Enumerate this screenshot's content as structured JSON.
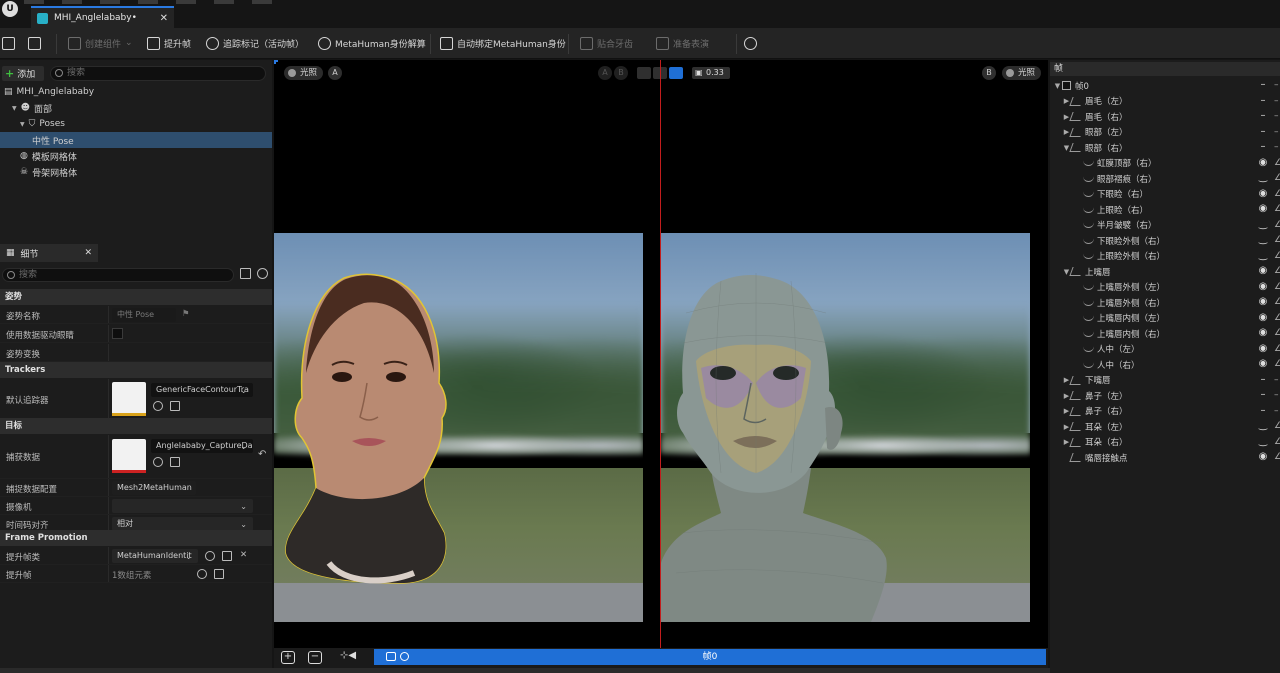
{
  "app": {
    "document_tab": "MHI_Anglelababy•",
    "logo": "U"
  },
  "toolbar": {
    "create_components": "创建组件",
    "promote_frame": "提升帧",
    "track_markers": "追踪标记（活动帧）",
    "metahuman_identity_solve": "MetaHuman身份解算",
    "auto_rig": "自动绑定MetaHuman身份",
    "fit_teeth": "贴合牙齿",
    "prepare_expression": "准备表演"
  },
  "outliner": {
    "add_label": "添加",
    "search_placeholder": "搜索",
    "items": [
      {
        "label": "MHI_Anglelababy",
        "indent": 0,
        "icon": "component-icon"
      },
      {
        "label": "面部",
        "indent": 1,
        "icon": "face-icon"
      },
      {
        "label": "Poses",
        "indent": 2,
        "icon": "poses-icon"
      },
      {
        "label": "中性 Pose",
        "indent": 3,
        "icon": "",
        "selected": true
      },
      {
        "label": "模板网格体",
        "indent": 2,
        "icon": "mesh-icon"
      },
      {
        "label": "骨架网格体",
        "indent": 2,
        "icon": "skeleton-icon"
      }
    ]
  },
  "details": {
    "tab_label": "细节",
    "search_placeholder": "搜索",
    "sections": {
      "pose": "姿势",
      "trackers": "Trackers",
      "target": "目标",
      "frame_promotion": "Frame Promotion"
    },
    "props": {
      "pose_name_label": "姿势名称",
      "pose_name_value": "中性 Pose",
      "use_data_eye_label": "使用数据驱动眼睛",
      "pose_transform_label": "姿势变换",
      "default_tracker_label": "默认追踪器",
      "default_tracker_value": "GenericFaceContourTra",
      "capture_data_label": "捕获数据",
      "capture_data_value": "Anglelababy_CaptureDa",
      "capture_config_label": "捕捉数据配置",
      "capture_config_value": "Mesh2MetaHuman",
      "camera_label": "摄像机",
      "camera_value": "",
      "timecode_align_label": "时间码对齐",
      "timecode_align_value": "相对",
      "promoter_class_label": "提升帧类",
      "promoter_class_value": "MetaHumanIdentit",
      "promoted_frames_label": "提升帧",
      "promoted_frames_value": "1数组元素"
    }
  },
  "viewport": {
    "left_lighting": "光照",
    "left_letter": "A",
    "mode_a": "A",
    "mode_b": "B",
    "frame_value": "0.33",
    "right_letter": "B",
    "right_lighting": "光照"
  },
  "timeline": {
    "frame_label": "帧0"
  },
  "frames_panel": {
    "title": "帧",
    "root": "帧0",
    "items": [
      {
        "label": "眉毛（左）",
        "level": 1,
        "expandable": true,
        "vis": "–"
      },
      {
        "label": "眉毛（右）",
        "level": 1,
        "expandable": true,
        "vis": "–"
      },
      {
        "label": "眼部（左）",
        "level": 1,
        "expandable": true,
        "vis": "–"
      },
      {
        "label": "眼部（右）",
        "level": 1,
        "expandable": true,
        "expanded": true,
        "vis": "–"
      },
      {
        "label": "虹膜顶部（右）",
        "level": 2,
        "vis": "eye"
      },
      {
        "label": "眼部褶痕（右）",
        "level": 2,
        "vis": "closed"
      },
      {
        "label": "下眼睑（右）",
        "level": 2,
        "vis": "eye"
      },
      {
        "label": "上眼睑（右）",
        "level": 2,
        "vis": "eye"
      },
      {
        "label": "半月皱襞（右）",
        "level": 2,
        "vis": "closed"
      },
      {
        "label": "下眼睑外侧（右）",
        "level": 2,
        "vis": "closed"
      },
      {
        "label": "上眼睑外侧（右）",
        "level": 2,
        "vis": "closed"
      },
      {
        "label": "上嘴唇",
        "level": 1,
        "expandable": true,
        "expanded": true,
        "vis": "eye"
      },
      {
        "label": "上嘴唇外侧（左）",
        "level": 2,
        "vis": "eye"
      },
      {
        "label": "上嘴唇外侧（右）",
        "level": 2,
        "vis": "eye"
      },
      {
        "label": "上嘴唇内侧（左）",
        "level": 2,
        "vis": "eye"
      },
      {
        "label": "上嘴唇内侧（右）",
        "level": 2,
        "vis": "eye"
      },
      {
        "label": "人中（左）",
        "level": 2,
        "vis": "eye"
      },
      {
        "label": "人中（右）",
        "level": 2,
        "vis": "eye"
      },
      {
        "label": "下嘴唇",
        "level": 1,
        "expandable": true,
        "vis": "–"
      },
      {
        "label": "鼻子（左）",
        "level": 1,
        "expandable": true,
        "vis": "–"
      },
      {
        "label": "鼻子（右）",
        "level": 1,
        "expandable": true,
        "vis": "–"
      },
      {
        "label": "耳朵（左）",
        "level": 1,
        "expandable": true,
        "vis": "closed"
      },
      {
        "label": "耳朵（右）",
        "level": 1,
        "expandable": true,
        "vis": "closed"
      },
      {
        "label": "嘴唇接触点",
        "level": 1,
        "vis": "eye"
      }
    ]
  },
  "colors": {
    "accent": "#1f6fd6",
    "selection": "#2e4e6e",
    "divider_line": "#c21d1d",
    "add_plus": "#3fbf3f",
    "tracker_bar": "#d9a21a",
    "capture_bar": "#cc2222"
  }
}
